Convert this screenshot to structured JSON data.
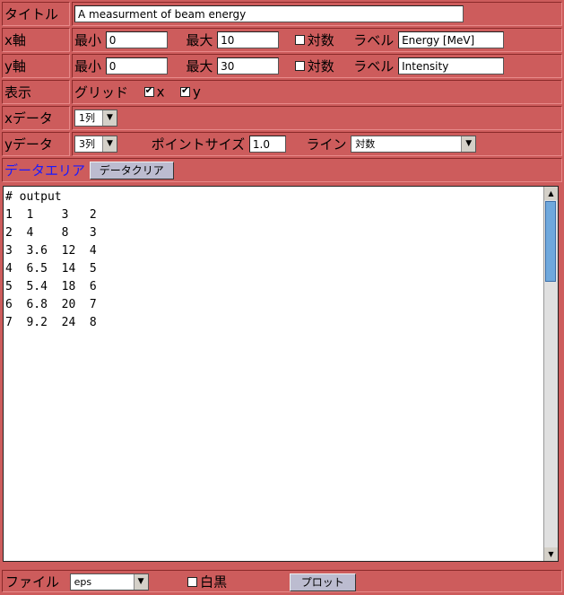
{
  "title_row": {
    "label": "タイトル",
    "value": "A measurment of beam energy"
  },
  "x_axis": {
    "label": "x軸",
    "min_label": "最小",
    "min_value": "0",
    "max_label": "最大",
    "max_value": "10",
    "log_label": "対数",
    "log_checked": false,
    "axis_label_label": "ラベル",
    "axis_label_value": "Energy [MeV]"
  },
  "y_axis": {
    "label": "y軸",
    "min_label": "最小",
    "min_value": "0",
    "max_label": "最大",
    "max_value": "30",
    "log_label": "対数",
    "log_checked": false,
    "axis_label_label": "ラベル",
    "axis_label_value": "Intensity"
  },
  "display": {
    "label": "表示",
    "grid_label": "グリッド",
    "grid_x_label": "x",
    "grid_x_checked": true,
    "grid_y_label": "y",
    "grid_y_checked": true
  },
  "x_data": {
    "label": "xデータ",
    "selected": "1列"
  },
  "y_data": {
    "label": "yデータ",
    "selected": "3列",
    "point_size_label": "ポイントサイズ",
    "point_size_value": "1.0",
    "line_label": "ライン",
    "line_selected": "対数"
  },
  "data_area": {
    "label": "データエリア",
    "clear_button": "データクリア"
  },
  "data_text": "# output\n1  1    3   2\n2  4    8   3\n3  3.6  12  4\n4  6.5  14  5\n5  5.4  18  6\n6  6.8  20  7\n7  9.2  24  8",
  "bottom": {
    "file_label": "ファイル",
    "file_selected": "eps",
    "mono_label": "白黒",
    "mono_checked": false,
    "plot_button": "プロット"
  }
}
